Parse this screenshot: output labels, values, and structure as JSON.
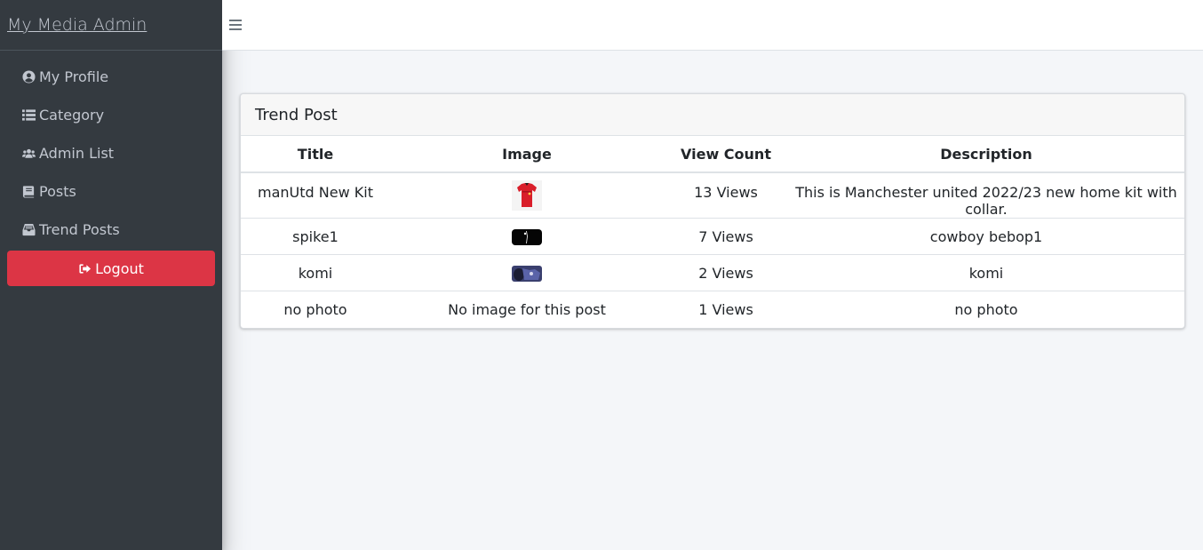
{
  "brand": {
    "title": "My Media Admin"
  },
  "sidebar": {
    "items": [
      {
        "label": "My Profile",
        "icon": "user-circle-icon"
      },
      {
        "label": "Category",
        "icon": "list-icon"
      },
      {
        "label": "Admin List",
        "icon": "users-icon"
      },
      {
        "label": "Posts",
        "icon": "book-icon"
      },
      {
        "label": "Trend Posts",
        "icon": "inbox-icon"
      }
    ],
    "logout": {
      "label": "Logout",
      "icon": "sign-out-icon"
    }
  },
  "card": {
    "title": "Trend Post",
    "columns": [
      "Title",
      "Image",
      "View Count",
      "Description"
    ],
    "rows": [
      {
        "title": "manUtd New Kit",
        "image": "red-jersey-thumbnail",
        "views": "13 Views",
        "description": "This is Manchester united 2022/23 new home kit with collar."
      },
      {
        "title": "spike1",
        "image": "dark-thumbnail",
        "views": "7 Views",
        "description": "cowboy bebop1"
      },
      {
        "title": "komi",
        "image": "anime-thumbnail",
        "views": "2 Views",
        "description": "komi"
      },
      {
        "title": "no photo",
        "image_text": "No image for this post",
        "views": "1 Views",
        "description": "no photo"
      }
    ]
  },
  "colors": {
    "sidebar_bg": "#343a40",
    "logout_bg": "#dc3545",
    "page_bg": "#f4f6f9"
  }
}
